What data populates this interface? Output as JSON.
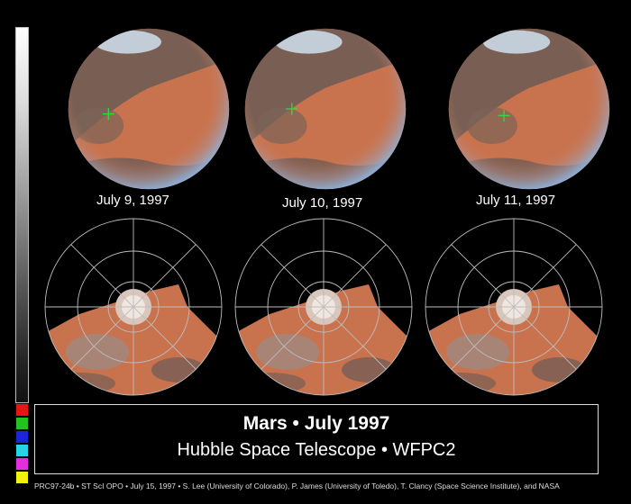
{
  "panels": [
    {
      "date": "July 9, 1997"
    },
    {
      "date": "July 10, 1997"
    },
    {
      "date": "July 11, 1997"
    }
  ],
  "colors": {
    "mars_orange": "#c9734e",
    "mars_dark": "#6b5a55",
    "atmosphere_blue": "#8fb0d8",
    "marker_green": "#39d33a",
    "grid_line": "#bdbdbd"
  },
  "color_swatches": [
    "#e8141a",
    "#22c31f",
    "#1b25d9",
    "#25d5e6",
    "#e42fe0",
    "#f4f20c"
  ],
  "caption": {
    "title": "Mars • July 1997",
    "subtitle": "Hubble Space Telescope • WFPC2"
  },
  "credit": "PRC97-24b • ST ScI OPO • July 15, 1997 • S. Lee (University of Colorado), P. James (University of Toledo), T. Clancy (Space Science Institute),  and NASA"
}
